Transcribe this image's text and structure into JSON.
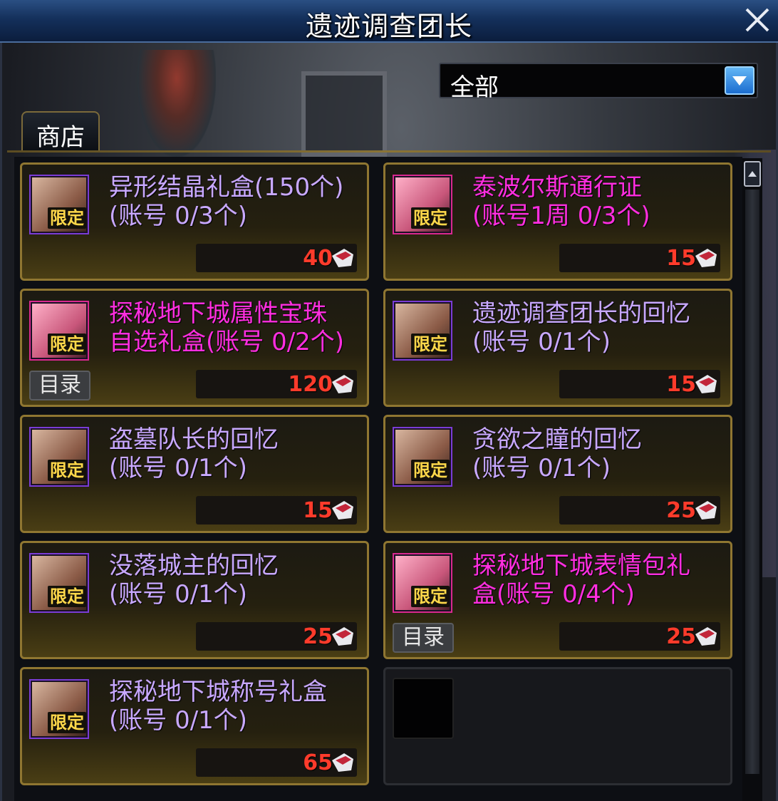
{
  "window": {
    "title": "遗迹调查团长"
  },
  "filter": {
    "selected": "全部"
  },
  "tabs": [
    {
      "label": "商店"
    }
  ],
  "items": [
    {
      "name_line1": "异形结晶礼盒(150个)",
      "name_line2": "(账号 0/3个)",
      "price": "40",
      "badge": "限定",
      "color": "purple",
      "catalog": ""
    },
    {
      "name_line1": "泰波尔斯通行证",
      "name_line2": "(账号1周 0/3个)",
      "price": "15",
      "badge": "限定",
      "color": "pink",
      "catalog": ""
    },
    {
      "name_line1": "探秘地下城属性宝珠",
      "name_line2": "自选礼盒(账号 0/2个)",
      "price": "120",
      "badge": "限定",
      "color": "pink",
      "catalog": "目录"
    },
    {
      "name_line1": "遗迹调查团长的回忆",
      "name_line2": "(账号 0/1个)",
      "price": "15",
      "badge": "限定",
      "color": "purple",
      "catalog": ""
    },
    {
      "name_line1": "盗墓队长的回忆",
      "name_line2": "(账号 0/1个)",
      "price": "15",
      "badge": "限定",
      "color": "purple",
      "catalog": ""
    },
    {
      "name_line1": "贪欲之瞳的回忆",
      "name_line2": "(账号 0/1个)",
      "price": "25",
      "badge": "限定",
      "color": "purple",
      "catalog": ""
    },
    {
      "name_line1": "没落城主的回忆",
      "name_line2": "(账号 0/1个)",
      "price": "25",
      "badge": "限定",
      "color": "purple",
      "catalog": ""
    },
    {
      "name_line1": "探秘地下城表情包礼",
      "name_line2": "盒(账号 0/4个)",
      "price": "25",
      "badge": "限定",
      "color": "pink",
      "catalog": "目录"
    },
    {
      "name_line1": "探秘地下城称号礼盒",
      "name_line2": "(账号 0/1个)",
      "price": "65",
      "badge": "限定",
      "color": "purple",
      "catalog": ""
    }
  ],
  "icons": {
    "close": "close-icon",
    "dropdown": "chevron-down-icon",
    "scroll_up": "arrow-up-icon",
    "currency": "coin-icon"
  },
  "colors": {
    "name_purple": "#c8a8ff",
    "name_pink": "#ff2ee0",
    "price_red": "#ff3b2b",
    "card_border_gold": "#8f7631",
    "badge_yellow": "#ffd84a"
  }
}
